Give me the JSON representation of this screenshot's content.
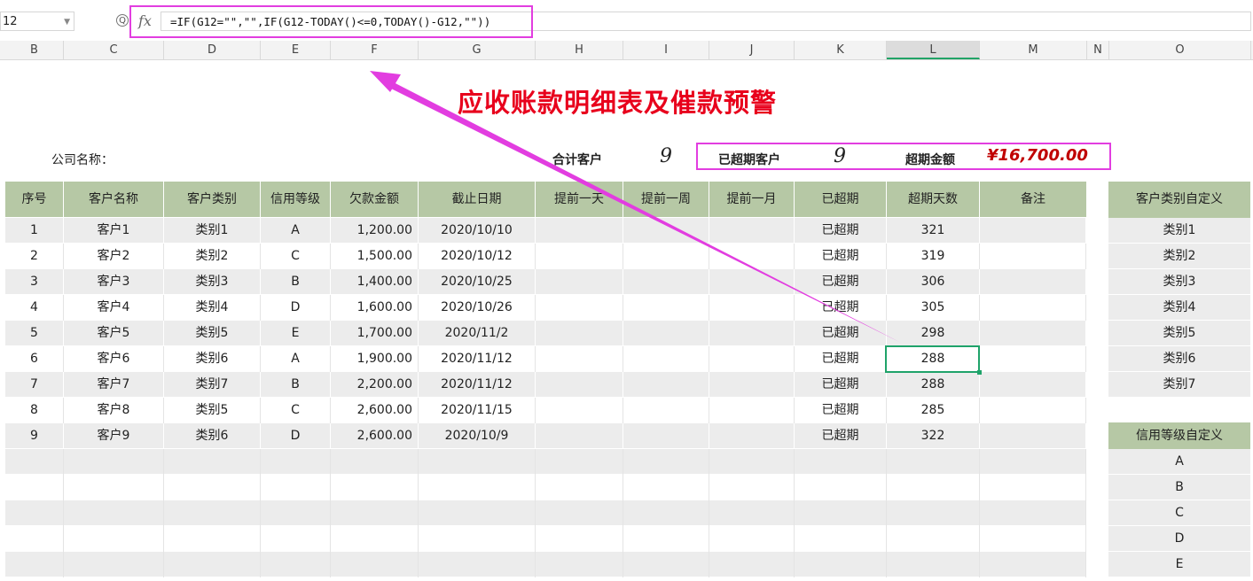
{
  "formula_bar": {
    "name_box": "12",
    "fx_label": "fx",
    "zoom_glyph": "Q",
    "formula": "=IF(G12=\"\",\"\",IF(G12-TODAY()<=0,TODAY()-G12,\"\"))"
  },
  "column_headers": [
    "B",
    "C",
    "D",
    "E",
    "F",
    "G",
    "H",
    "I",
    "J",
    "K",
    "L",
    "M",
    "N",
    "O"
  ],
  "selected_column": "L",
  "title": "应收账款明细表及催款预警",
  "summary": {
    "company_label": "公司名称：",
    "total_customers_label": "合计客户",
    "total_customers_value": "9",
    "overdue_customers_label": "已超期客户",
    "overdue_customers_value": "9",
    "overdue_amount_label": "超期金额",
    "overdue_amount_value": "¥16,700.00"
  },
  "table": {
    "headers": [
      "序号",
      "客户名称",
      "客户类别",
      "信用等级",
      "欠款金额",
      "截止日期",
      "提前一天",
      "提前一周",
      "提前一月",
      "已超期",
      "超期天数",
      "备注"
    ],
    "rows": [
      [
        "1",
        "客户1",
        "类别1",
        "A",
        "1,200.00",
        "2020/10/10",
        "",
        "",
        "",
        "已超期",
        "321",
        ""
      ],
      [
        "2",
        "客户2",
        "类别2",
        "C",
        "1,500.00",
        "2020/10/12",
        "",
        "",
        "",
        "已超期",
        "319",
        ""
      ],
      [
        "3",
        "客户3",
        "类别3",
        "B",
        "1,400.00",
        "2020/10/25",
        "",
        "",
        "",
        "已超期",
        "306",
        ""
      ],
      [
        "4",
        "客户4",
        "类别4",
        "D",
        "1,600.00",
        "2020/10/26",
        "",
        "",
        "",
        "已超期",
        "305",
        ""
      ],
      [
        "5",
        "客户5",
        "类别5",
        "E",
        "1,700.00",
        "2020/11/2",
        "",
        "",
        "",
        "已超期",
        "298",
        ""
      ],
      [
        "6",
        "客户6",
        "类别6",
        "A",
        "1,900.00",
        "2020/11/12",
        "",
        "",
        "",
        "已超期",
        "288",
        ""
      ],
      [
        "7",
        "客户7",
        "类别7",
        "B",
        "2,200.00",
        "2020/11/12",
        "",
        "",
        "",
        "已超期",
        "288",
        ""
      ],
      [
        "8",
        "客户8",
        "类别5",
        "C",
        "2,600.00",
        "2020/11/15",
        "",
        "",
        "",
        "已超期",
        "285",
        ""
      ],
      [
        "9",
        "客户9",
        "类别6",
        "D",
        "2,600.00",
        "2020/10/9",
        "",
        "",
        "",
        "已超期",
        "322",
        ""
      ]
    ]
  },
  "customer_type_list": {
    "header": "客户类别自定义",
    "items": [
      "类别1",
      "类别2",
      "类别3",
      "类别4",
      "类别5",
      "类别6",
      "类别7"
    ]
  },
  "credit_grade_list": {
    "header": "信用等级自定义",
    "items": [
      "A",
      "B",
      "C",
      "D",
      "E"
    ]
  },
  "colors": {
    "header_fill": "#b6c8a5",
    "title_red": "#e8001c",
    "annotation_magenta": "#e23de0",
    "active_cell_green": "#1fa36a",
    "amount_red": "#c00000"
  }
}
